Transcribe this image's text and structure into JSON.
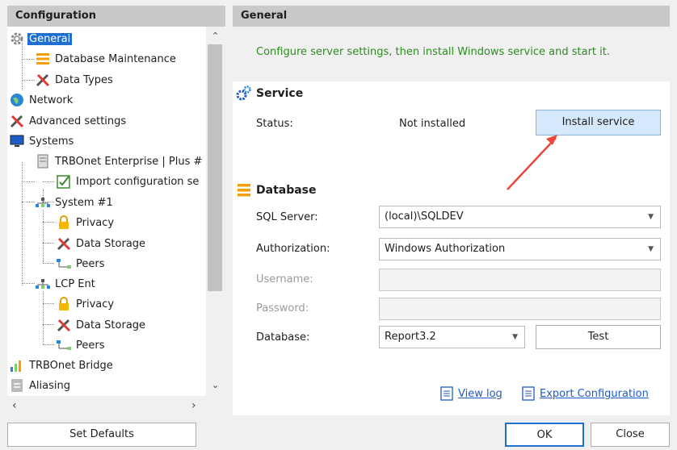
{
  "left_panel": {
    "title": "Configuration",
    "tree": [
      {
        "label": "General",
        "icon": "gear-icon",
        "selected": true
      },
      {
        "label": "Database Maintenance",
        "icon": "database-maintenance-icon"
      },
      {
        "label": "Data Types",
        "icon": "tools-icon"
      },
      {
        "label": "Network",
        "icon": "network-globe-icon"
      },
      {
        "label": "Advanced settings",
        "icon": "tools-icon"
      },
      {
        "label": "Systems",
        "icon": "monitor-icon"
      },
      {
        "label": "TRBOnet Enterprise | Plus #",
        "icon": "server-icon"
      },
      {
        "label": "Import configuration se",
        "icon": "import-check-icon"
      },
      {
        "label": "System #1",
        "icon": "system-network-icon"
      },
      {
        "label": "Privacy",
        "icon": "lock-icon"
      },
      {
        "label": "Data Storage",
        "icon": "tools-icon"
      },
      {
        "label": "Peers",
        "icon": "peers-icon"
      },
      {
        "label": "LCP Ent",
        "icon": "system-network-icon"
      },
      {
        "label": "Privacy",
        "icon": "lock-icon"
      },
      {
        "label": "Data Storage",
        "icon": "tools-icon"
      },
      {
        "label": "Peers",
        "icon": "peers-icon"
      },
      {
        "label": "TRBOnet Bridge",
        "icon": "bars-chart-icon"
      },
      {
        "label": "Aliasing",
        "icon": "document-icon"
      }
    ]
  },
  "right_panel": {
    "title": "General",
    "hint": "Configure server settings, then install Windows service and start it.",
    "service": {
      "title": "Service",
      "status_label": "Status:",
      "status_value": "Not installed",
      "install_button": "Install service"
    },
    "database": {
      "title": "Database",
      "sql_server_label": "SQL Server:",
      "sql_server_value": "(local)\\SQLDEV",
      "authorization_label": "Authorization:",
      "authorization_value": "Windows Authorization",
      "username_label": "Username:",
      "password_label": "Password:",
      "database_label": "Database:",
      "database_value": "Report3.2",
      "test_button": "Test"
    },
    "links": {
      "view_log": "View log",
      "export_configuration": "Export Configuration"
    }
  },
  "footer": {
    "set_defaults": "Set Defaults",
    "ok": "OK",
    "close": "Close"
  },
  "colors": {
    "selection": "#1f6fd0",
    "hint_text": "#2e8b22",
    "link": "#1f5bc4",
    "button_highlight": "#d6e8fb",
    "annotation_arrow": "#e8473a"
  }
}
